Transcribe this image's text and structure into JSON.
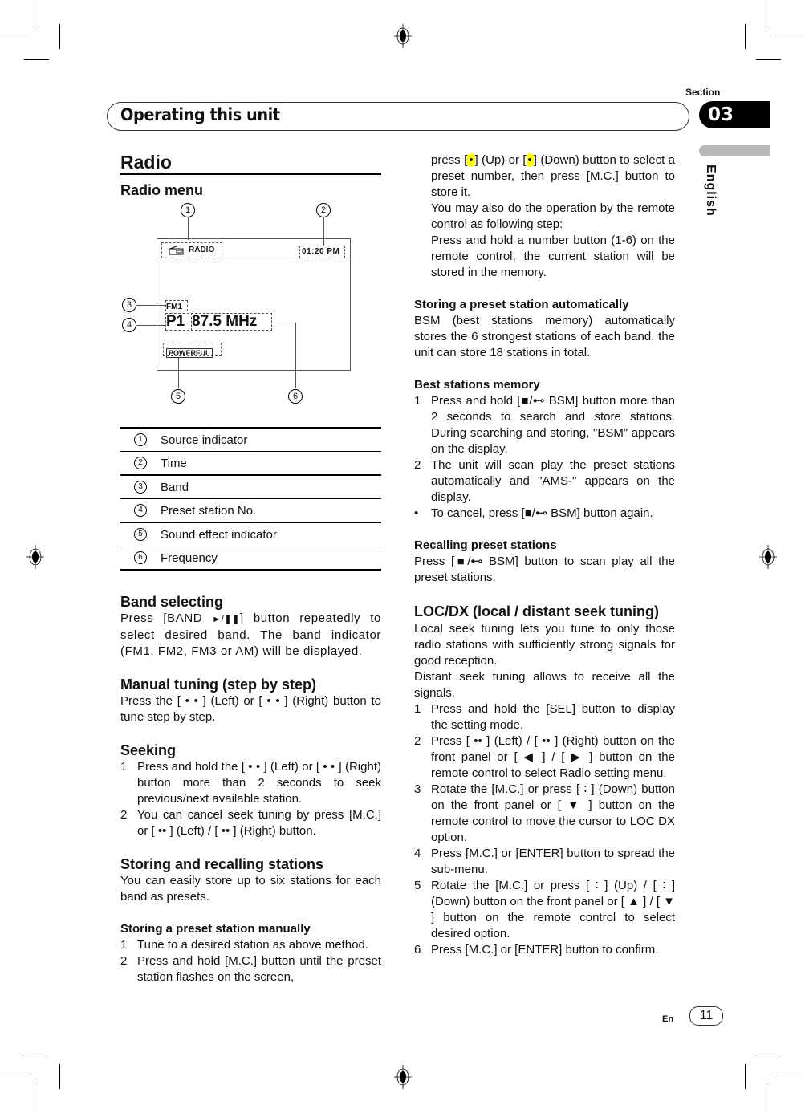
{
  "header": {
    "title": "Operating this unit",
    "section_label": "Section",
    "section_number": "03",
    "language": "English"
  },
  "left": {
    "radio_title": "Radio",
    "radio_menu_title": "Radio menu",
    "diagram": {
      "callouts": [
        "1",
        "2",
        "3",
        "4",
        "5",
        "6"
      ],
      "source_label": "RADIO",
      "source_icon": "radio-icon",
      "time": "01:20 PM",
      "band": "FM1",
      "preset": "P1",
      "frequency": "87.5 MHz",
      "sound_effect": "POWERFUL"
    },
    "legend": [
      {
        "num": "1",
        "label": "Source indicator"
      },
      {
        "num": "2",
        "label": "Time"
      },
      {
        "num": "3",
        "label": "Band"
      },
      {
        "num": "4",
        "label": "Preset station No."
      },
      {
        "num": "5",
        "label": "Sound effect indicator"
      },
      {
        "num": "6",
        "label": "Frequency"
      }
    ],
    "band_selecting": {
      "title": "Band selecting",
      "text_before": "Press [BAND ",
      "icon": "play-pause-icon",
      "text_after": "] button repeatedly to select desired band. The band indicator (FM1, FM2, FM3 or AM) will be displayed."
    },
    "manual_tuning": {
      "title": "Manual tuning (step by step)",
      "text": "Press the [ • • ] (Left) or [ • • ] (Right) button to tune step by step."
    },
    "seeking": {
      "title": "Seeking",
      "steps": [
        {
          "n": "1",
          "text": "Press and hold the [ • • ] (Left) or [ • • ] (Right) button more than 2 seconds to seek previous/next available station."
        },
        {
          "n": "2",
          "text": "You can cancel seek tuning by press [M.C.] or [ •• ] (Left) / [ •• ] (Right) button."
        }
      ]
    },
    "storing": {
      "title": "Storing and recalling stations",
      "text": "You can easily store up to six stations for each band as presets."
    },
    "storing_manual": {
      "title": "Storing a preset station manually",
      "steps": [
        {
          "n": "1",
          "text": "Tune to a desired station as above method."
        },
        {
          "n": "2",
          "text": "Press and hold [M.C.] button until the preset station flashes on the screen,"
        }
      ]
    }
  },
  "right": {
    "continued": {
      "part1": "press [",
      "up_glyph": "•",
      "part2": "] (Up) or [",
      "down_glyph": "•",
      "part3": "] (Down) button to select a preset number, then press [M.C.] button to store it.",
      "remote_intro": "You may also do the operation by the remote control as following step:",
      "remote_step": "Press and hold a number button (1-6) on the remote control, the current station will be stored in the memory."
    },
    "storing_auto": {
      "title": "Storing a preset station automatically",
      "text": "BSM (best stations memory) automatically stores the 6 strongest stations of each band, the unit can store 18 stations in total."
    },
    "bsm": {
      "title": "Best stations memory",
      "steps": [
        {
          "n": "1",
          "text": "Press and hold [■/⊷ BSM] button more than 2 seconds to search and store stations. During searching and storing, \"BSM\" appears on the display."
        },
        {
          "n": "2",
          "text": "The unit will scan play the preset stations automatically and \"AMS-\" appears on the display."
        },
        {
          "n": "•",
          "text": "To cancel, press [■/⊷ BSM] button again."
        }
      ]
    },
    "recalling": {
      "title": "Recalling preset stations",
      "text": "Press [■/⊷ BSM] button to scan play all the preset stations."
    },
    "locdx": {
      "title": "LOC/DX (local / distant seek tuning)",
      "p1": "Local seek tuning lets you tune to only those radio stations with sufficiently strong signals for good reception.",
      "p2": "Distant seek tuning allows to receive all the signals.",
      "steps": [
        {
          "n": "1",
          "text": "Press and hold the [SEL] button to display the setting mode."
        },
        {
          "n": "2",
          "text": "Press [ •• ] (Left) / [ •• ] (Right) button on the front panel or [ ◀ ] / [ ▶ ] button on the remote control to select Radio setting menu."
        },
        {
          "n": "3",
          "text": "Rotate the [M.C.] or press [ ∶ ] (Down) button on the front panel or [ ▼ ] button on the remote control to move the cursor to  LOC DX option."
        },
        {
          "n": "4",
          "text": "Press [M.C.] or [ENTER] button to spread the sub-menu."
        },
        {
          "n": "5",
          "text": "Rotate the [M.C.] or press [ ∶ ] (Up) / [ ∶ ] (Down) button on the front panel or [ ▲ ] / [ ▼ ] button on the remote control to select desired option."
        },
        {
          "n": "6",
          "text": "Press [M.C.] or [ENTER] button to confirm."
        }
      ]
    }
  },
  "footer": {
    "lang_code": "En",
    "page_number": "11"
  }
}
